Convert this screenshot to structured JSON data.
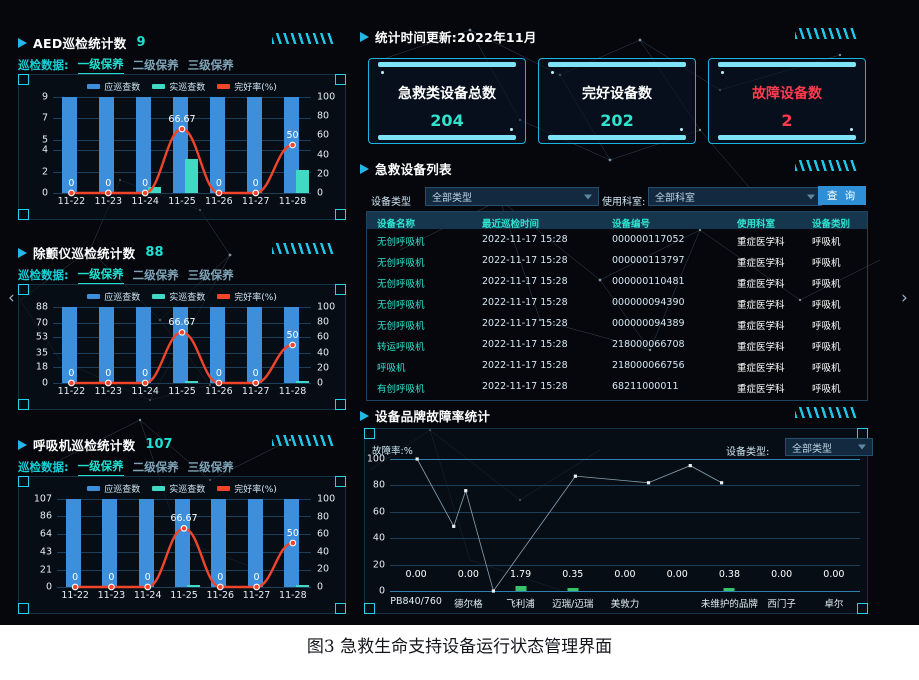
{
  "caption": "图3 急救生命支持设备运行状态管理界面",
  "colors": {
    "bg": "#05070d",
    "accent_cyan": "#1fe0d0",
    "bar_blue": "#3d8fdb",
    "bar_teal": "#3fd9c4",
    "line_red": "#f0452b",
    "danger_red": "#ff3b4e",
    "panel_border": "#153247"
  },
  "maintenance_tabs": {
    "label": "巡检数据:",
    "tabs": [
      "一级保养",
      "二级保养",
      "三级保养"
    ],
    "active_index": 0
  },
  "legend": [
    {
      "name": "应巡查数",
      "color": "#3d8fdb"
    },
    {
      "name": "实巡查数",
      "color": "#3fd9c4"
    },
    {
      "name": "完好率(%)",
      "color": "#f0452b"
    }
  ],
  "left_panels": [
    {
      "title": "AED巡检统计数",
      "count": "9",
      "chart_data": {
        "type": "bar",
        "title": "AED巡检统计数",
        "categories": [
          "11-22",
          "11-23",
          "11-24",
          "11-25",
          "11-26",
          "11-27",
          "11-28"
        ],
        "series": [
          {
            "name": "应巡查数",
            "type": "bar",
            "values": [
              9,
              9,
              9,
              9,
              9,
              9,
              9
            ]
          },
          {
            "name": "实巡查数",
            "type": "bar",
            "values": [
              0,
              0,
              0.6,
              3.2,
              0,
              0,
              2.2
            ]
          },
          {
            "name": "完好率(%)",
            "type": "line",
            "values": [
              0,
              0,
              0,
              66.67,
              0,
              0,
              50
            ]
          }
        ],
        "point_labels": [
          "0",
          "0",
          "0",
          "66.67",
          "0",
          "0",
          "50"
        ],
        "yticks_left": [
          0,
          2,
          4,
          5,
          7,
          9
        ],
        "yticks_right": [
          0,
          20,
          40,
          60,
          80,
          100
        ],
        "ylim_left": [
          0,
          9
        ],
        "ylim_right": [
          0,
          100
        ],
        "xlabel": "",
        "ylabel": "",
        "grid": true,
        "legend_position": "top"
      }
    },
    {
      "title": "除颤仪巡检统计数",
      "count": "88",
      "chart_data": {
        "type": "bar",
        "title": "除颤仪巡检统计数",
        "categories": [
          "11-22",
          "11-23",
          "11-24",
          "11-25",
          "11-26",
          "11-27",
          "11-28"
        ],
        "series": [
          {
            "name": "应巡查数",
            "type": "bar",
            "values": [
              88,
              88,
              88,
              88,
              88,
              88,
              88
            ]
          },
          {
            "name": "实巡查数",
            "type": "bar",
            "values": [
              0,
              0,
              0,
              2.5,
              0,
              0,
              2
            ]
          },
          {
            "name": "完好率(%)",
            "type": "line",
            "values": [
              0,
              0,
              0,
              66.67,
              0,
              0,
              50
            ]
          }
        ],
        "point_labels": [
          "0",
          "0",
          "0",
          "66.67",
          "0",
          "0",
          "50"
        ],
        "yticks_left": [
          0,
          18,
          35,
          53,
          70,
          88
        ],
        "yticks_right": [
          0,
          20,
          40,
          60,
          80,
          100
        ],
        "ylim_left": [
          0,
          88
        ],
        "ylim_right": [
          0,
          100
        ],
        "xlabel": "",
        "ylabel": "",
        "grid": true,
        "legend_position": "top"
      }
    },
    {
      "title": "呼吸机巡检统计数",
      "count": "107",
      "chart_data": {
        "type": "bar",
        "title": "呼吸机巡检统计数",
        "categories": [
          "11-22",
          "11-23",
          "11-24",
          "11-25",
          "11-26",
          "11-27",
          "11-28"
        ],
        "series": [
          {
            "name": "应巡查数",
            "type": "bar",
            "values": [
              107,
              107,
              107,
              107,
              107,
              107,
              107
            ]
          },
          {
            "name": "实巡查数",
            "type": "bar",
            "values": [
              0,
              0,
              0,
              2.5,
              0,
              0,
              2
            ]
          },
          {
            "name": "完好率(%)",
            "type": "line",
            "values": [
              0,
              0,
              0,
              66.67,
              0,
              0,
              50
            ]
          }
        ],
        "point_labels": [
          "0",
          "0",
          "0",
          "66.67",
          "0",
          "0",
          "50"
        ],
        "yticks_left": [
          0,
          21,
          43,
          64,
          86,
          107
        ],
        "yticks_right": [
          0,
          20,
          40,
          60,
          80,
          100
        ],
        "ylim_left": [
          0,
          107
        ],
        "ylim_right": [
          0,
          100
        ],
        "xlabel": "",
        "ylabel": "",
        "grid": true,
        "legend_position": "top"
      }
    }
  ],
  "stats_header": {
    "title": "统计时间更新:2022年11月"
  },
  "kpis": [
    {
      "title": "急救类设备总数",
      "value": "204",
      "title_color": "#ffffff",
      "value_color": "#2fe3cf"
    },
    {
      "title": "完好设备数",
      "value": "202",
      "title_color": "#ffffff",
      "value_color": "#2fe3cf"
    },
    {
      "title": "故障设备数",
      "value": "2",
      "title_color": "#ff3b4e",
      "value_color": "#ff3b4e"
    }
  ],
  "device_list": {
    "title": "急救设备列表",
    "filters": {
      "type_label": "设备类型",
      "type_value": "全部类型",
      "dept_label": "使用科室:",
      "dept_value": "全部科室",
      "query_button": "查 询"
    },
    "columns": [
      "设备名称",
      "最近巡检时间",
      "设备编号",
      "使用科室",
      "设备类别"
    ],
    "rows": [
      [
        "无创呼吸机",
        "2022-11-17 15:28",
        "000000117052",
        "重症医学科",
        "呼吸机"
      ],
      [
        "无创呼吸机",
        "2022-11-17 15:28",
        "000000113797",
        "重症医学科",
        "呼吸机"
      ],
      [
        "无创呼吸机",
        "2022-11-17 15:28",
        "000000110481",
        "重症医学科",
        "呼吸机"
      ],
      [
        "无创呼吸机",
        "2022-11-17 15:28",
        "000000094390",
        "重症医学科",
        "呼吸机"
      ],
      [
        "无创呼吸机",
        "2022-11-17 15:28",
        "000000094389",
        "重症医学科",
        "呼吸机"
      ],
      [
        "转运呼吸机",
        "2022-11-17 15:28",
        "218000066708",
        "重症医学科",
        "呼吸机"
      ],
      [
        "呼吸机",
        "2022-11-17 15:28",
        "218000066756",
        "重症医学科",
        "呼吸机"
      ],
      [
        "有创呼吸机",
        "2022-11-17 15:28",
        "68211000011",
        "重症医学科",
        "呼吸机"
      ]
    ]
  },
  "brand_failure": {
    "title": "设备品牌故障率统计",
    "filter_label": "设备类型:",
    "filter_value": "全部类型",
    "chart_data": {
      "type": "scatter",
      "title": "设备品牌故障率统计",
      "ylabel": "故障率:%",
      "xlabel": "",
      "categories": [
        "PB840/760",
        "德尔格",
        "飞利浦",
        "迈瑞/迈瑞",
        "美敦力",
        "",
        "未维护的品牌",
        "西门子",
        "卓尔"
      ],
      "values": [
        0.0,
        0.0,
        1.79,
        0.35,
        0.0,
        0.0,
        0.38,
        0.0,
        0.0
      ],
      "data_labels": [
        "0.00",
        "0.00",
        "1.79",
        "0.35",
        "0.00",
        "0.00",
        "0.38",
        "0.00",
        "0.00"
      ],
      "scatter_points": [
        {
          "x": 0.02,
          "y": 100
        },
        {
          "x": 0.72,
          "y": 49
        },
        {
          "x": 0.95,
          "y": 76
        },
        {
          "x": 1.48,
          "y": 0
        },
        {
          "x": 3.05,
          "y": 87
        },
        {
          "x": 4.45,
          "y": 82
        },
        {
          "x": 5.25,
          "y": 95
        },
        {
          "x": 5.85,
          "y": 82
        }
      ],
      "yticks": [
        0,
        20,
        40,
        60,
        80,
        100
      ],
      "ylim": [
        0,
        100
      ],
      "grid": true,
      "legend_position": "none"
    }
  },
  "nav": {
    "prev": "‹",
    "next": "›"
  }
}
